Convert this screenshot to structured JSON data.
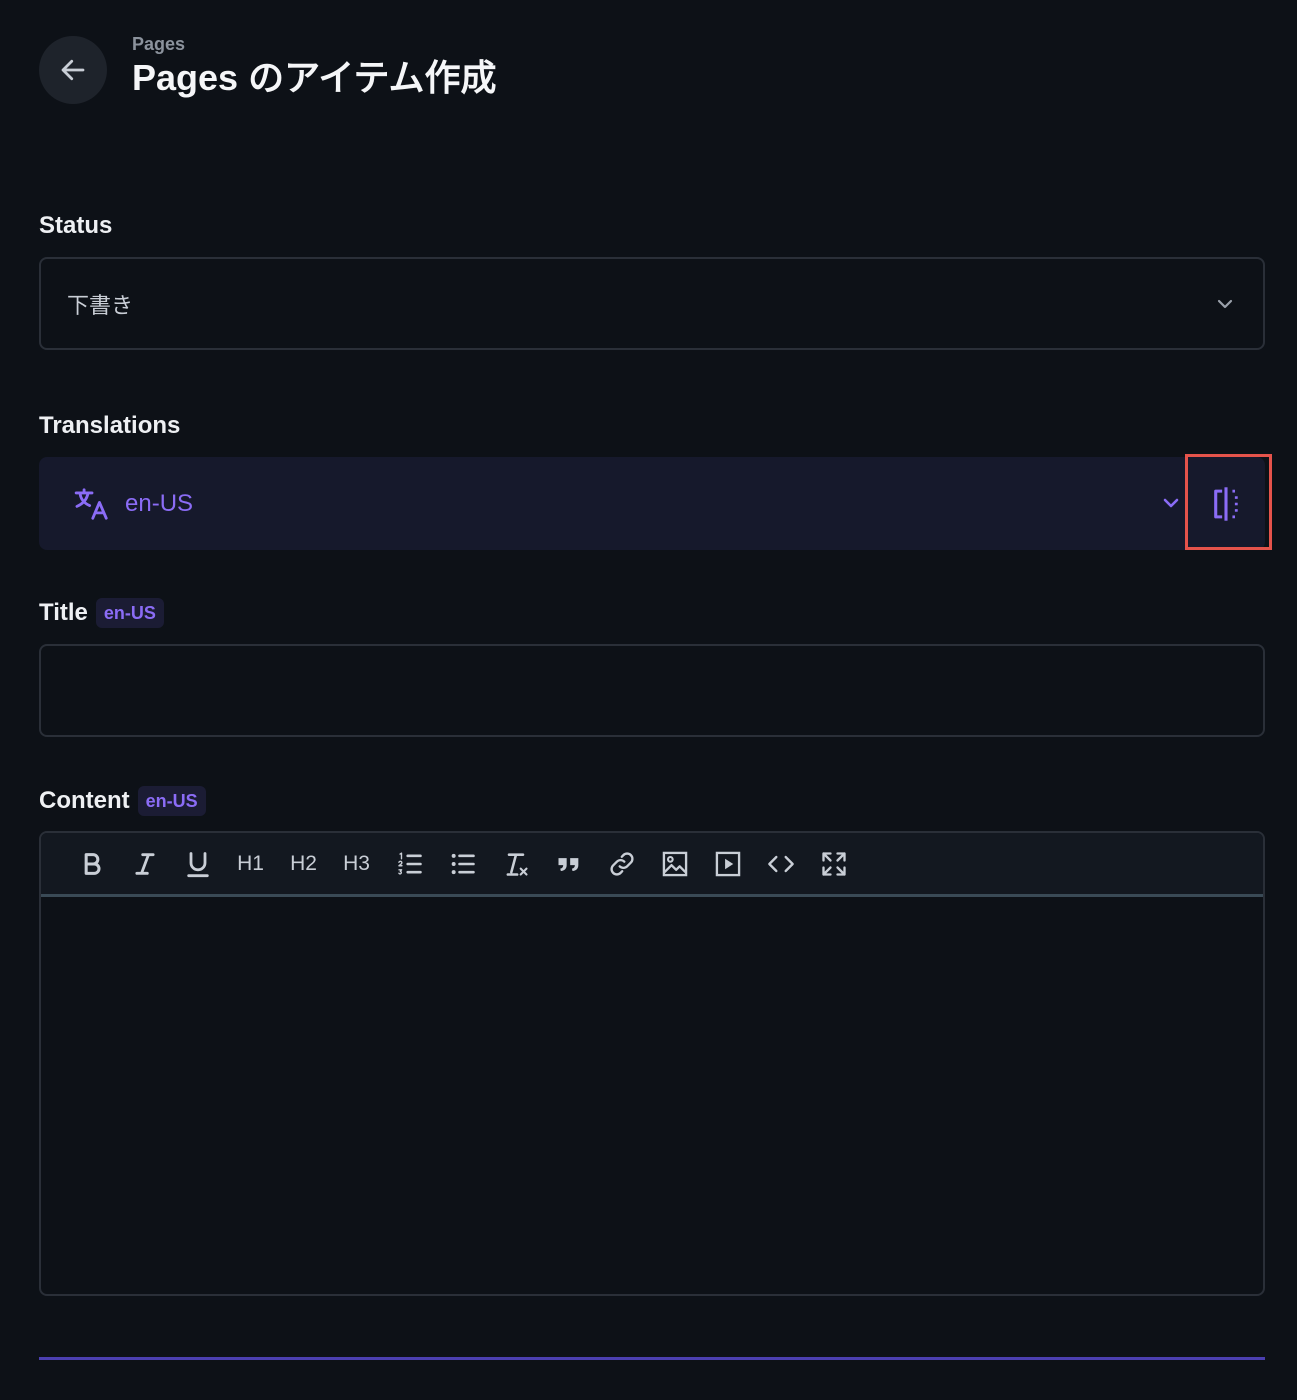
{
  "header": {
    "breadcrumb": "Pages",
    "title": "Pages のアイテム作成",
    "back_icon": "arrow-left-icon"
  },
  "status": {
    "label": "Status",
    "value": "下書き",
    "chevron_icon": "chevron-down-icon"
  },
  "translations": {
    "label": "Translations",
    "value": "en-US",
    "translate_icon": "translate-icon",
    "chevron_icon": "chevron-down-icon",
    "split_icon": "split-view-icon"
  },
  "title_field": {
    "label": "Title",
    "lang": "en-US",
    "value": ""
  },
  "content_field": {
    "label": "Content",
    "lang": "en-US",
    "toolbar": {
      "h1": "H1",
      "h2": "H2",
      "h3": "H3"
    }
  },
  "colors": {
    "background": "#0d1117",
    "accent": "#8b6cf6",
    "highlight": "#e5534b",
    "translation_bar": "#16192c"
  }
}
